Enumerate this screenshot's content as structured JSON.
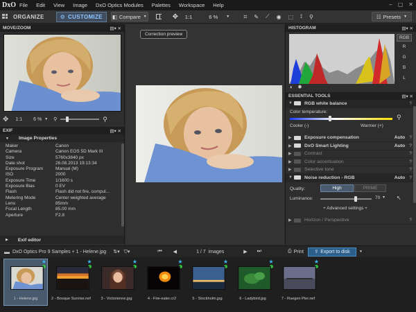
{
  "app": {
    "logo": "DxO"
  },
  "menu": [
    "File",
    "Edit",
    "View",
    "Image",
    "DxO Optics Modules",
    "Palettes",
    "Workspace",
    "Help"
  ],
  "window_controls": [
    "–",
    "▢",
    "✕"
  ],
  "toolbar": {
    "organize": "ORGANIZE",
    "customize": "CUSTOMIZE",
    "compare": "Compare",
    "zoom_ratio": "1:1",
    "zoom_percent": "6 %",
    "presets": "Presets"
  },
  "move_zoom": {
    "title": "MOVE/ZOOM",
    "ratio": "1:1",
    "percent": "6 %"
  },
  "exif": {
    "title": "EXIF",
    "section": "Image Properties",
    "rows": [
      {
        "k": "Maker",
        "v": "Canon"
      },
      {
        "k": "Camera",
        "v": "Canon EOS 5D Mark III"
      },
      {
        "k": "Size",
        "v": "5760x3840 px"
      },
      {
        "k": "Date shot",
        "v": "26.08.2013 19:13:34"
      },
      {
        "k": "Exposure Program",
        "v": "Manual (M)"
      },
      {
        "k": "ISO",
        "v": "2000"
      },
      {
        "k": "Exposure Time",
        "v": "1/1600 s"
      },
      {
        "k": "Exposure Bias",
        "v": "0 EV"
      },
      {
        "k": "Flash",
        "v": "Flash did not fire, compul..."
      },
      {
        "k": "Metering Mode",
        "v": "Center weighted average"
      },
      {
        "k": "Lens",
        "v": "85mm"
      },
      {
        "k": "Focal Length",
        "v": "85.00 mm"
      },
      {
        "k": "Aperture",
        "v": "F2.8"
      }
    ],
    "editor": "Exif editor"
  },
  "preview": {
    "correction_preview": "Correction preview"
  },
  "histogram": {
    "title": "HISTOGRAM",
    "channels": [
      "RGB",
      "R",
      "G",
      "B",
      "L"
    ],
    "active_channel": "RGB"
  },
  "essential_tools": {
    "title": "ESSENTIAL TOOLS",
    "white_balance": {
      "title": "RGB white balance",
      "color_temp": "Color temperature:",
      "cooler": "Cooler (-)",
      "warmer": "Warmer (+)"
    },
    "tools": [
      {
        "name": "Exposure compensation",
        "auto": "Auto",
        "on": true
      },
      {
        "name": "DxO Smart Lighting",
        "auto": "Auto",
        "on": true
      },
      {
        "name": "Contrast",
        "auto": "",
        "on": false
      },
      {
        "name": "Color accentuation",
        "auto": "",
        "on": false
      },
      {
        "name": "Selective tone",
        "auto": "",
        "on": false
      }
    ],
    "noise": {
      "title": "Noise reduction - RGB",
      "auto": "Auto",
      "quality": "Quality:",
      "high": "High",
      "prime": "PRIME",
      "luminance": "Luminance:",
      "luminance_value": "70",
      "advanced": "+ Advanced settings +"
    },
    "horizon": "Horizon / Perspective"
  },
  "filmstrip": {
    "path": "DxO Optics Pro 9 Samples + 1 - Helene.jpg",
    "counter": "1 / 7",
    "images_label": "images",
    "print": "Print",
    "export": "Export to disk",
    "thumbs": [
      "1 - Helene.jpg",
      "2 - Bosque Sunrise.nef",
      "3 - Victorienne.jpg",
      "4 - Fire-eater.cr2",
      "5 - Stockholm.jpg",
      "6 - Ladybird.jpg",
      "7 - Ruegen Pier.nef"
    ]
  },
  "colors": {
    "accent": "#3fb6f0",
    "customize_active": "#8ec6ff",
    "export_button": "#2c5f8a"
  }
}
